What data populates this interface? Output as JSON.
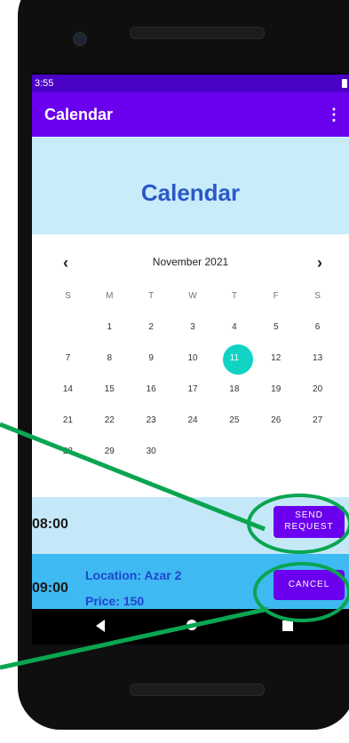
{
  "status_bar": {
    "time": "3:55"
  },
  "app_bar": {
    "title": "Calendar",
    "menu_icon": "more-vert-icon",
    "menu_glyph": "⋮"
  },
  "header": {
    "title": "Calendar"
  },
  "calendar": {
    "month_label": "November 2021",
    "prev_glyph": "‹",
    "next_glyph": "›",
    "weekdays": [
      "S",
      "M",
      "T",
      "W",
      "T",
      "F",
      "S"
    ],
    "weeks": [
      [
        "",
        "1",
        "2",
        "3",
        "4",
        "5",
        "6"
      ],
      [
        "7",
        "8",
        "9",
        "10",
        "11",
        "12",
        "13"
      ],
      [
        "14",
        "15",
        "16",
        "17",
        "18",
        "19",
        "20"
      ],
      [
        "21",
        "22",
        "23",
        "24",
        "25",
        "26",
        "27"
      ],
      [
        "28",
        "29",
        "30",
        "",
        "",
        "",
        ""
      ]
    ],
    "selected_day": "11",
    "selected_color": "#10d3c4"
  },
  "slots": [
    {
      "time": "08:00",
      "button_line1": "SEND",
      "button_line2": "REQUEST"
    },
    {
      "time": "09:00",
      "location": "Location: Azar 2",
      "price": "Price: 150",
      "button": "CANCEL"
    }
  ],
  "colors": {
    "status_bar": "#4a02c6",
    "app_bar": "#6a00ee",
    "header_bg": "#c9ecfb",
    "slot_free": "#c5e8f8",
    "slot_booked": "#3fb9f2",
    "annotation": "#0aa551"
  }
}
